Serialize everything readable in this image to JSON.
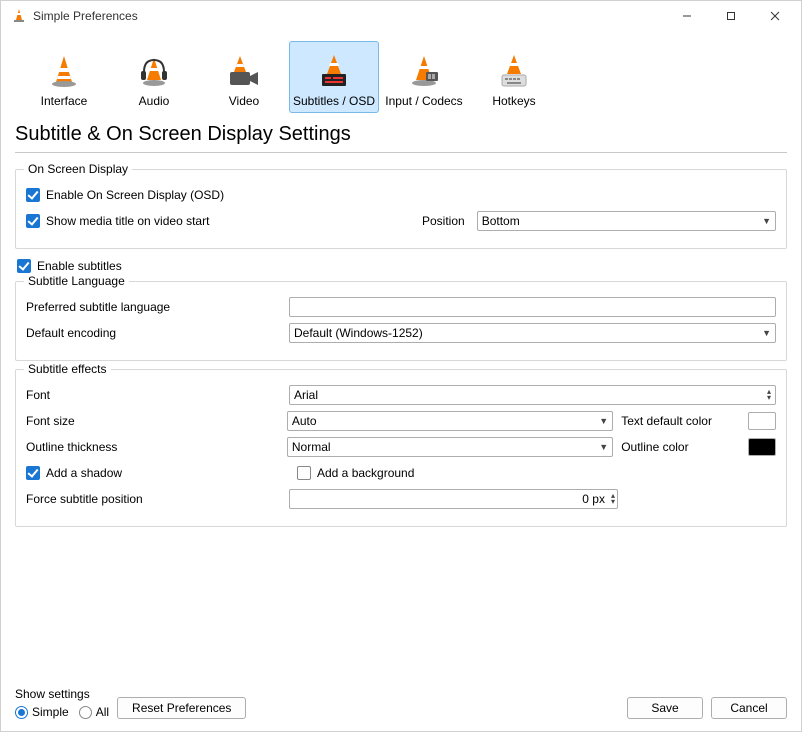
{
  "window_title": "Simple Preferences",
  "tabs": [
    {
      "label": "Interface"
    },
    {
      "label": "Audio"
    },
    {
      "label": "Video"
    },
    {
      "label": "Subtitles / OSD"
    },
    {
      "label": "Input / Codecs"
    },
    {
      "label": "Hotkeys"
    }
  ],
  "selected_tab_index": 3,
  "main_heading": "Subtitle & On Screen Display Settings",
  "osd_group": {
    "title": "On Screen Display",
    "enable_osd_label": "Enable On Screen Display (OSD)",
    "show_title_label": "Show media title on video start",
    "position_label": "Position",
    "position_value": "Bottom"
  },
  "enable_subtitles_label": "Enable subtitles",
  "language_group": {
    "title": "Subtitle Language",
    "preferred_label": "Preferred subtitle language",
    "preferred_value": "",
    "encoding_label": "Default encoding",
    "encoding_value": "Default (Windows-1252)"
  },
  "effects_group": {
    "title": "Subtitle effects",
    "font_label": "Font",
    "font_value": "Arial",
    "font_size_label": "Font size",
    "font_size_value": "Auto",
    "text_color_label": "Text default color",
    "outline_thickness_label": "Outline thickness",
    "outline_thickness_value": "Normal",
    "outline_color_label": "Outline color",
    "add_shadow_label": "Add a shadow",
    "add_background_label": "Add a background",
    "force_position_label": "Force subtitle position",
    "force_position_value": "0 px"
  },
  "footer": {
    "show_settings_label": "Show settings",
    "simple_label": "Simple",
    "all_label": "All",
    "reset_label": "Reset Preferences",
    "save_label": "Save",
    "cancel_label": "Cancel"
  }
}
